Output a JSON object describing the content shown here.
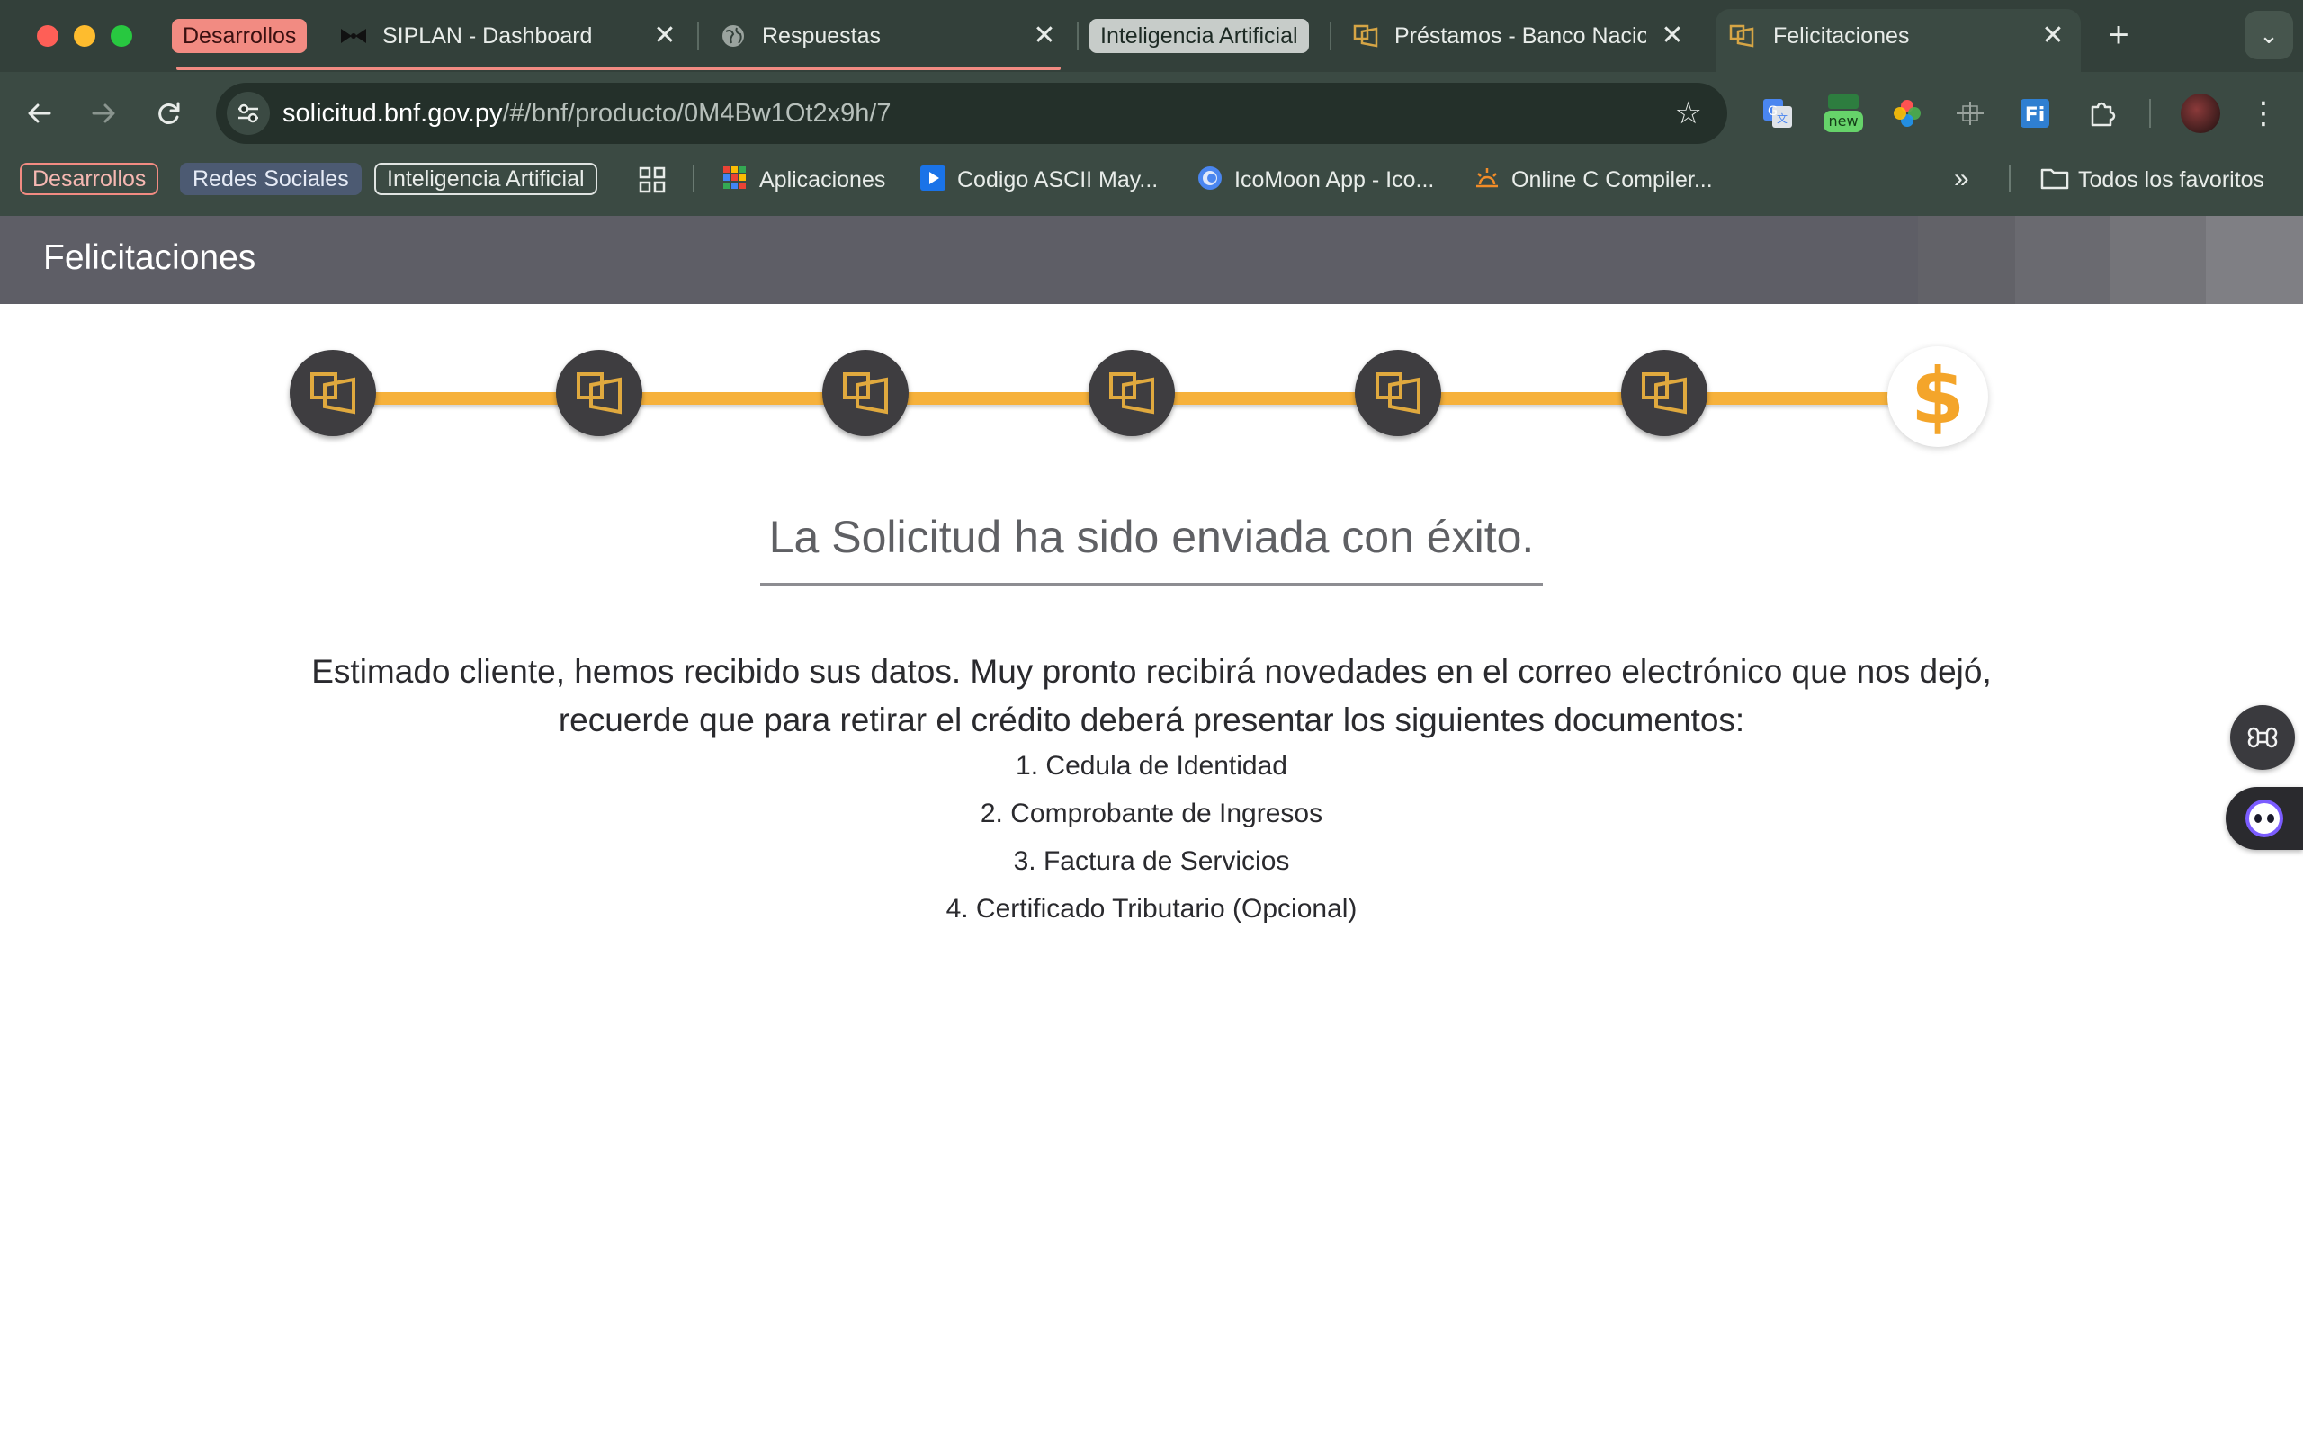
{
  "browser": {
    "tab_groups": {
      "dev": "Desarrollos",
      "ai": "Inteligencia Artificial"
    },
    "tabs": [
      {
        "title": "SIPLAN - Dashboard",
        "icon": "bowtie-icon"
      },
      {
        "title": "Respuestas",
        "icon": "globe-icon"
      },
      {
        "title": "Préstamos - Banco Nacional de Fomento",
        "icon": "bnf-logo-icon"
      },
      {
        "title": "Felicitaciones",
        "icon": "bnf-logo-icon",
        "active": true
      }
    ],
    "url": {
      "host": "solicitud.bnf.gov.py",
      "path": "/#/bnf/producto/0M4Bw1Ot2x9h/7"
    },
    "extension_badge": "new",
    "bookmarks": {
      "chips": [
        "Desarrollos",
        "Redes Sociales",
        "Inteligencia Artificial"
      ],
      "items": [
        {
          "label": "Aplicaciones",
          "icon": "apps-grid-icon"
        },
        {
          "label": "Codigo ASCII May...",
          "icon": "play-icon"
        },
        {
          "label": "IcoMoon App - Ico...",
          "icon": "icomoon-icon"
        },
        {
          "label": "Online C Compiler...",
          "icon": "sun-icon"
        }
      ],
      "all_bookmarks": "Todos los favoritos"
    }
  },
  "page": {
    "header_title": "Felicitaciones",
    "steps_total": 7,
    "steps_completed": 6,
    "final_step_symbol": "$",
    "success_title": "La Solicitud ha sido enviada con éxito.",
    "message": "Estimado cliente, hemos recibido sus datos. Muy pronto recibirá novedades en el correo electrónico que nos dejó, recuerde que para retirar el crédito deberá presentar los siguientes documentos:",
    "documents": [
      "1. Cedula de Identidad",
      "2. Comprobante de Ingresos",
      "3. Factura de Servicios",
      "4. Certificado Tributario (Opcional)"
    ]
  },
  "colors": {
    "accent": "#f6b13b",
    "header_bg": "#5e5e66",
    "step_bg": "#3e3d40",
    "chrome_bg": "#3b4a43"
  }
}
